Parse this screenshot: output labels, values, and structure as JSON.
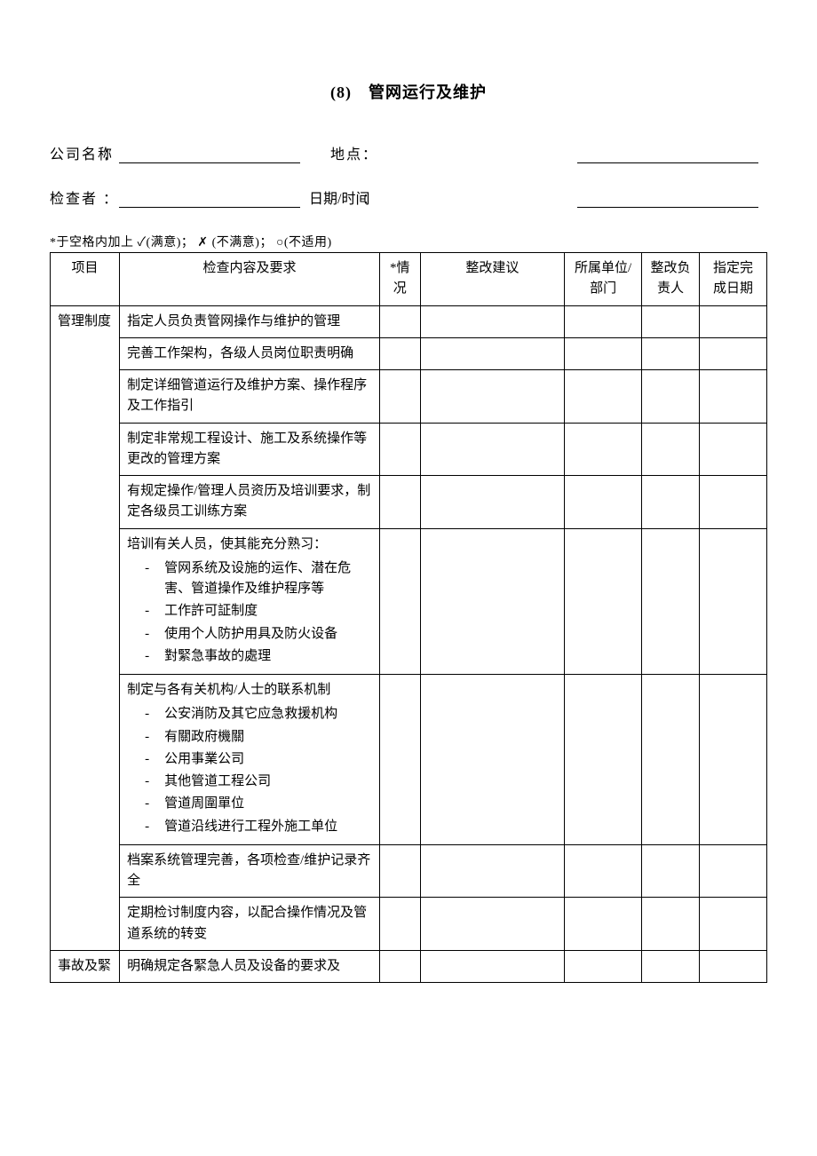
{
  "title": "(8)　管网运行及维护",
  "form": {
    "company_label": "公司名称",
    "location_label": "地点",
    "inspector_label": "检查者",
    "datetime_label": "日期/时间",
    "colon": "：",
    "company_value": "",
    "location_value": "",
    "inspector_value": "",
    "datetime_value": ""
  },
  "legend": "*于空格内加上 ✓(满意)； ✗ (不满意)； ○(不适用)",
  "headers": {
    "project": "项目",
    "requirement": "检查内容及要求",
    "status": "*情况",
    "suggestion": "整改建议",
    "dept": "所属单位/部门",
    "owner": "整改负责人",
    "deadline": "指定完成日期"
  },
  "sections": [
    {
      "project": "管理制度",
      "rows": [
        {
          "text": "指定人员负责管网操作与维护的管理"
        },
        {
          "text": "完善工作架构，各级人员岗位职责明确"
        },
        {
          "text": "制定详细管道运行及维护方案、操作程序及工作指引"
        },
        {
          "text": "制定非常规工程设计、施工及系统操作等更改的管理方案"
        },
        {
          "text": "有规定操作/管理人员资历及培训要求，制定各级员工训练方案"
        },
        {
          "intro": "培训有关人员，使其能充分熟习：",
          "bullets": [
            "管网系统及设施的运作、潜在危害、管道操作及维护程序等",
            "工作許可証制度",
            "使用个人防护用具及防火设备",
            "對緊急事故的處理"
          ]
        },
        {
          "intro": "制定与各有关机构/人士的联系机制",
          "bullets": [
            "公安消防及其它应急救援机构",
            "有關政府機關",
            "公用事業公司",
            "其他管道工程公司",
            "管道周圍單位",
            "管道沿线进行工程外施工单位"
          ]
        },
        {
          "text": "档案系统管理完善，各项检查/维护记录齐全"
        },
        {
          "text": "定期检讨制度内容，以配合操作情况及管道系统的转变"
        }
      ]
    },
    {
      "project": "事故及緊",
      "rows": [
        {
          "text": "明确規定各緊急人员及设备的要求及"
        }
      ]
    }
  ]
}
